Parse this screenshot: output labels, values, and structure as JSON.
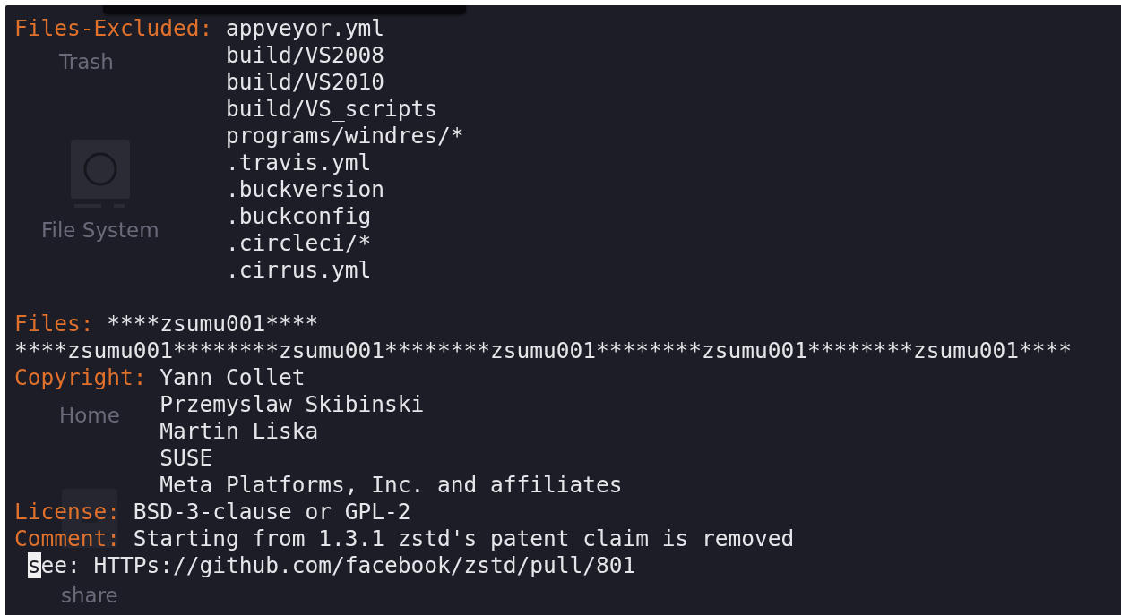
{
  "desktop_icons": [
    {
      "label": "Trash",
      "kind": "plain"
    },
    {
      "label": "File System",
      "kind": "drive"
    },
    {
      "label": "Home",
      "kind": "plain"
    },
    {
      "label": "share",
      "kind": "folder"
    }
  ],
  "terminal": {
    "lines": [
      {
        "kind": "field",
        "key": "Files-Excluded:",
        "value": "appveyor.yml"
      },
      {
        "kind": "cont",
        "value": "build/VS2008"
      },
      {
        "kind": "cont",
        "value": "build/VS2010"
      },
      {
        "kind": "cont",
        "value": "build/VS_scripts"
      },
      {
        "kind": "cont",
        "value": "programs/windres/*"
      },
      {
        "kind": "cont",
        "value": ".travis.yml"
      },
      {
        "kind": "cont",
        "value": ".buckversion"
      },
      {
        "kind": "cont",
        "value": ".buckconfig"
      },
      {
        "kind": "cont",
        "value": ".circleci/*"
      },
      {
        "kind": "cont",
        "value": ".cirrus.yml"
      },
      {
        "kind": "blank"
      },
      {
        "kind": "field",
        "key": "Files:",
        "value": "****zsumu001****"
      },
      {
        "kind": "wrap",
        "value": "****zsumu001********zsumu001********zsumu001********zsumu001********zsumu001****"
      },
      {
        "kind": "field",
        "key": "Copyright:",
        "value": "Yann Collet"
      },
      {
        "kind": "cont",
        "value": "Przemyslaw Skibinski"
      },
      {
        "kind": "cont",
        "value": "Martin Liska"
      },
      {
        "kind": "cont",
        "value": "SUSE"
      },
      {
        "kind": "cont",
        "value": "Meta Platforms, Inc. and affiliates"
      },
      {
        "kind": "field",
        "key": "License:",
        "value": "BSD-3-clause or GPL-2"
      },
      {
        "kind": "field",
        "key": "Comment:",
        "value": "Starting from 1.3.1 zstd's patent claim is removed"
      },
      {
        "kind": "cursor",
        "value": "see: HTTPs://github.com/facebook/zstd/pull/801"
      }
    ]
  }
}
